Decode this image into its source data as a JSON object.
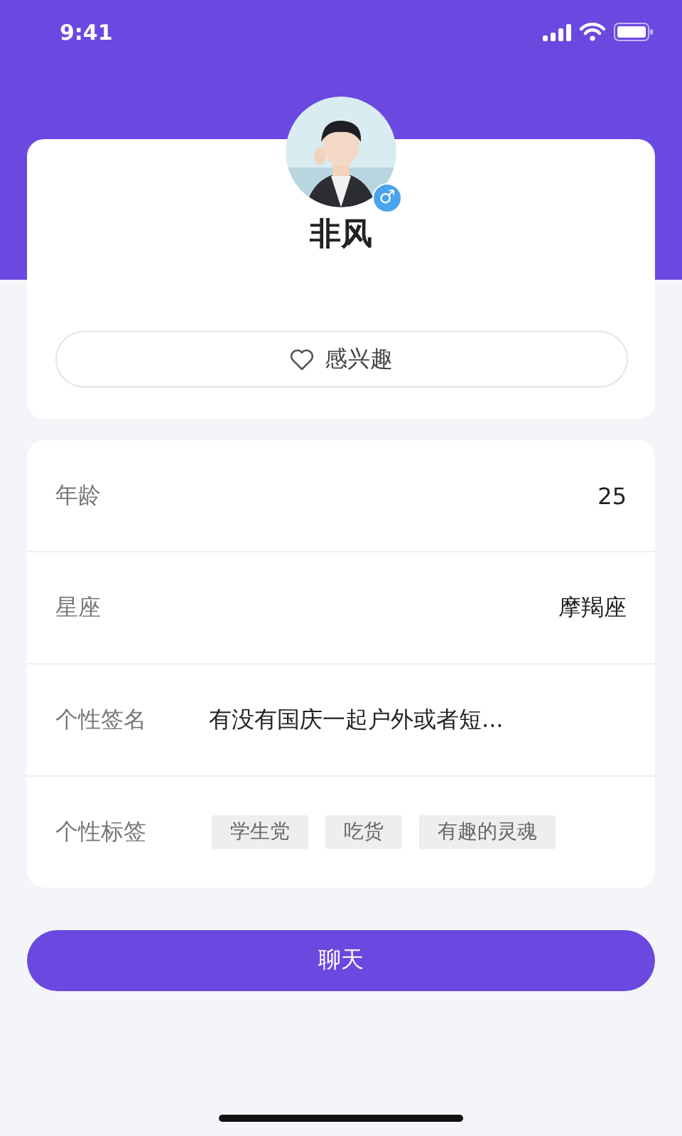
{
  "status_bar": {
    "time": "9:41"
  },
  "profile": {
    "gender_badge": "♂",
    "name": "非风",
    "interest_button": "感兴趣"
  },
  "info_rows": [
    {
      "kind": "value_right",
      "label": "年龄",
      "value": "25"
    },
    {
      "kind": "value_right",
      "label": "星座",
      "value": "摩羯座"
    },
    {
      "kind": "value_left",
      "label": "个性签名",
      "value": "有没有国庆一起户外或者短..."
    },
    {
      "kind": "tags",
      "label": "个性标签",
      "tags": [
        "学生党",
        "吃货",
        "有趣的灵魂"
      ]
    }
  ],
  "chat_button": "聊天"
}
